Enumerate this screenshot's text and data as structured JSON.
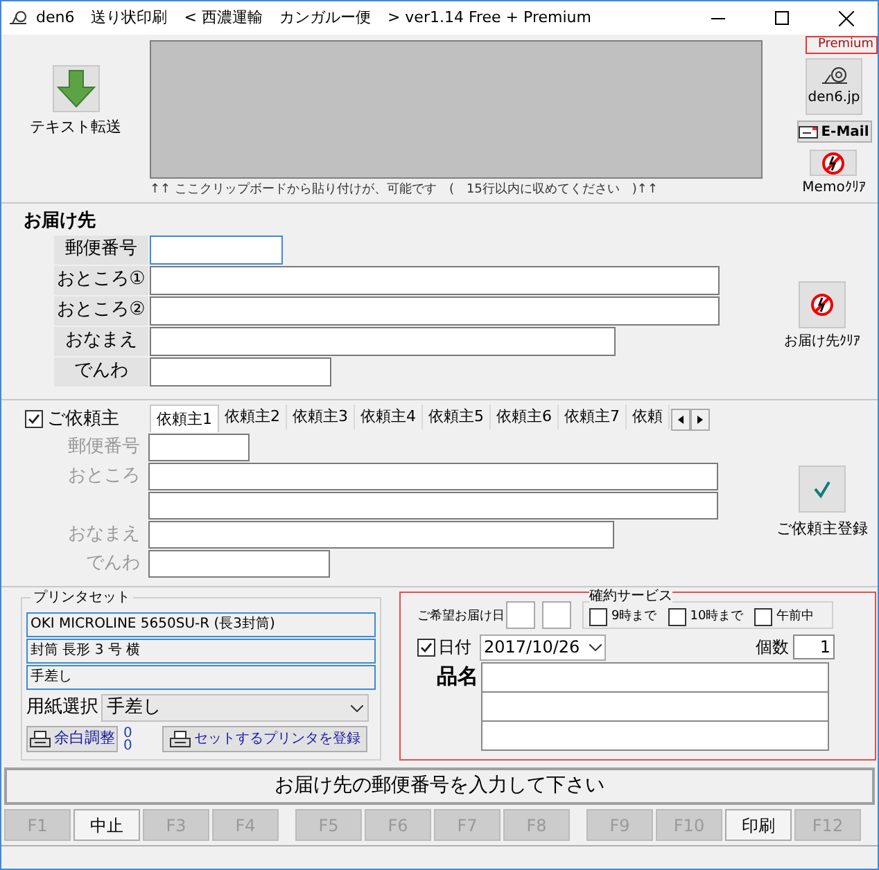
{
  "window": {
    "title_parts": [
      "den6",
      "送り状印刷",
      "< 西濃運輸",
      "カンガルー便",
      "> ver1.14 Free + Premium"
    ]
  },
  "premium_badge": "Premium",
  "transfer_button": {
    "label": "テキスト転送"
  },
  "clipboard_hint": "↑↑ ここクリップボードから貼り付けが、可能です　(　15行以内に収めてください　)↑↑",
  "side_buttons": [
    {
      "kind": "site",
      "label": "den6.jp"
    },
    {
      "kind": "mail",
      "label": "E-Mail"
    },
    {
      "kind": "clear",
      "label": "Memoｸﾘｱ"
    }
  ],
  "recipient": {
    "heading": "お届け先",
    "clear_button": "お届け先ｸﾘｱ",
    "fields": [
      {
        "kind": "zip",
        "label": "郵便番号",
        "focused": true
      },
      {
        "kind": "address",
        "label": "おところ①",
        "focused": false
      },
      {
        "kind": "address",
        "label": "おところ②",
        "focused": false
      },
      {
        "kind": "name",
        "label": "おなまえ",
        "focused": false
      },
      {
        "kind": "phone",
        "label": "でんわ",
        "focused": false
      }
    ]
  },
  "sender": {
    "checkbox": {
      "label": "ご依頼主",
      "checked": true
    },
    "tabs": [
      {
        "label": "依頼主1",
        "selected": true
      },
      {
        "label": "依頼主2",
        "selected": false
      },
      {
        "label": "依頼主3",
        "selected": false
      },
      {
        "label": "依頼主4",
        "selected": false
      },
      {
        "label": "依頼主5",
        "selected": false
      },
      {
        "label": "依頼主6",
        "selected": false
      },
      {
        "label": "依頼主7",
        "selected": false
      },
      {
        "label": "依頼",
        "selected": false
      }
    ],
    "fields": [
      {
        "kind": "zip",
        "label": "郵便番号"
      },
      {
        "kind": "address",
        "label": "おところ"
      },
      {
        "kind": "address"
      },
      {
        "kind": "name",
        "label": "おなまえ"
      },
      {
        "kind": "phone",
        "label": "でんわ"
      }
    ],
    "register_button": "ご依頼主登録"
  },
  "printer_set": {
    "title": "プリンタセット",
    "lines": [
      "OKI MICROLINE 5650SU-R (長3封筒)",
      "封筒 長形 3 号 横",
      "手差し"
    ],
    "paper_label": "用紙選択",
    "paper_value": "手差し",
    "margin_button": "余白調整",
    "margins": [
      "0",
      "0"
    ],
    "register_button": "セットするプリンタを登録"
  },
  "delivery": {
    "desired_date_label": "ご希望お届け日",
    "service": {
      "title": "確約サービス",
      "options": [
        {
          "label": "9時まで",
          "checked": false
        },
        {
          "label": "10時まで",
          "checked": false
        },
        {
          "label": "午前中",
          "checked": false
        }
      ]
    },
    "date": {
      "label": "日付",
      "checked": true,
      "value": "2017/10/26"
    },
    "count": {
      "label": "個数",
      "value": "1"
    },
    "item_label": "品名"
  },
  "status_message": "お届け先の郵便番号を入力して下さい",
  "function_keys": [
    {
      "label": "F1",
      "disabled": true
    },
    {
      "label": "中止",
      "disabled": false
    },
    {
      "label": "F3",
      "disabled": true
    },
    {
      "label": "F4",
      "disabled": true
    },
    {
      "label": "F5",
      "disabled": true
    },
    {
      "label": "F6",
      "disabled": true
    },
    {
      "label": "F7",
      "disabled": true
    },
    {
      "label": "F8",
      "disabled": true
    },
    {
      "label": "F9",
      "disabled": true
    },
    {
      "label": "F10",
      "disabled": true
    },
    {
      "label": "印刷",
      "disabled": false
    },
    {
      "label": "F12",
      "disabled": true
    }
  ]
}
